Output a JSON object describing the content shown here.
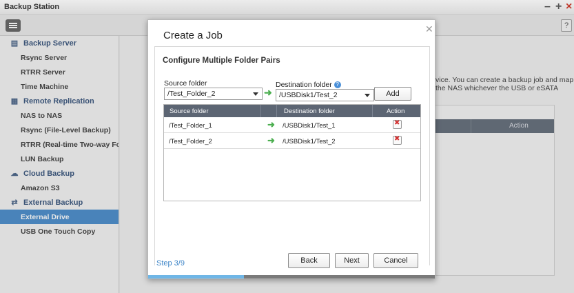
{
  "window": {
    "title": "Backup Station"
  },
  "toolbar": {
    "help_label": "?"
  },
  "sidebar": {
    "sections": [
      {
        "label": "Backup Server",
        "icon": "server-icon",
        "items": [
          "Rsync Server",
          "RTRR Server",
          "Time Machine"
        ]
      },
      {
        "label": "Remote Replication",
        "icon": "replication-icon",
        "items": [
          "NAS to NAS",
          "Rsync (File-Level Backup)",
          "RTRR (Real-time Two-way Folder ..",
          "LUN Backup"
        ]
      },
      {
        "label": "Cloud Backup",
        "icon": "cloud-icon",
        "items": [
          "Amazon S3"
        ]
      },
      {
        "label": "External Backup",
        "icon": "sync-icon",
        "items": [
          "External Drive",
          "USB One Touch Copy"
        ]
      }
    ],
    "active_item": "External Drive"
  },
  "background": {
    "line1": "vice. You can create a backup job and map",
    "line2": "the NAS whichever the USB or eSATA",
    "action_header": "Action"
  },
  "dialog": {
    "title": "Create a Job",
    "subtitle": "Configure Multiple Folder Pairs",
    "source_label": "Source folder",
    "source_value": "/Test_Folder_2",
    "destination_label": "Destination folder",
    "destination_value": "/USBDisk1/Test_2",
    "add_label": "Add",
    "table": {
      "headers": [
        "Source folder",
        "Destination folder",
        "Action"
      ],
      "rows": [
        {
          "source": "/Test_Folder_1",
          "destination": "/USBDisk1/Test_1"
        },
        {
          "source": "/Test_Folder_2",
          "destination": "/USBDisk1/Test_2"
        }
      ]
    },
    "step": "Step 3/9",
    "progress_fraction": 0.333,
    "back_label": "Back",
    "next_label": "Next",
    "cancel_label": "Cancel"
  }
}
